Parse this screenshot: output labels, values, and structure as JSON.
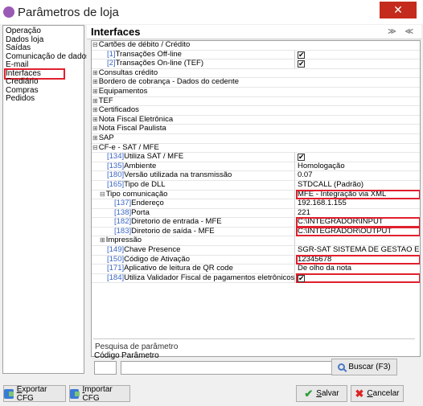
{
  "window": {
    "title": "Parâmetros de loja",
    "close": "✕"
  },
  "sidebar": {
    "items": [
      {
        "label": "Operação",
        "active": false
      },
      {
        "label": "Dados loja",
        "active": false
      },
      {
        "label": "Saídas",
        "active": false
      },
      {
        "label": "Comunicação de dados",
        "active": false
      },
      {
        "label": "E-mail",
        "active": false
      },
      {
        "label": "Interfaces",
        "active": true
      },
      {
        "label": "Crediário",
        "active": false
      },
      {
        "label": "Compras",
        "active": false
      },
      {
        "label": "Pedidos",
        "active": false
      }
    ]
  },
  "panel": {
    "title": "Interfaces",
    "icons": "≫ ≪"
  },
  "grid": {
    "rows": [
      {
        "indent": 0,
        "exp": "⊟",
        "code": "",
        "label": "Cartões de débito / Crédito",
        "value": "",
        "checkbox": false,
        "group": true,
        "highlight": false
      },
      {
        "indent": 2,
        "exp": "",
        "code": "[1]",
        "label": "Transações Off-line",
        "value": "",
        "checkbox": true,
        "group": false,
        "highlight": false
      },
      {
        "indent": 2,
        "exp": "",
        "code": "[2]",
        "label": "Transações On-line (TEF)",
        "value": "",
        "checkbox": true,
        "group": false,
        "highlight": false
      },
      {
        "indent": 0,
        "exp": "⊞",
        "code": "",
        "label": "Consultas crédito",
        "value": "",
        "checkbox": false,
        "group": true,
        "highlight": false
      },
      {
        "indent": 0,
        "exp": "⊞",
        "code": "",
        "label": "Bordero de cobrança - Dados do cedente",
        "value": "",
        "checkbox": false,
        "group": true,
        "highlight": false
      },
      {
        "indent": 0,
        "exp": "⊞",
        "code": "",
        "label": "Equipamentos",
        "value": "",
        "checkbox": false,
        "group": true,
        "highlight": false
      },
      {
        "indent": 0,
        "exp": "⊞",
        "code": "",
        "label": "TEF",
        "value": "",
        "checkbox": false,
        "group": true,
        "highlight": false
      },
      {
        "indent": 0,
        "exp": "⊞",
        "code": "",
        "label": "Certificados",
        "value": "",
        "checkbox": false,
        "group": true,
        "highlight": false
      },
      {
        "indent": 0,
        "exp": "⊞",
        "code": "",
        "label": "Nota Fiscal Eletrônica",
        "value": "",
        "checkbox": false,
        "group": true,
        "highlight": false
      },
      {
        "indent": 0,
        "exp": "⊞",
        "code": "",
        "label": "Nota Fiscal Paulista",
        "value": "",
        "checkbox": false,
        "group": true,
        "highlight": false
      },
      {
        "indent": 0,
        "exp": "⊞",
        "code": "",
        "label": "SAP",
        "value": "",
        "checkbox": false,
        "group": true,
        "highlight": false
      },
      {
        "indent": 0,
        "exp": "⊟",
        "code": "",
        "label": "CF-e - SAT / MFE",
        "value": "",
        "checkbox": false,
        "group": true,
        "highlight": false
      },
      {
        "indent": 2,
        "exp": "",
        "code": "[134]",
        "label": "Utiliza SAT / MFE",
        "value": "",
        "checkbox": true,
        "group": false,
        "highlight": false
      },
      {
        "indent": 2,
        "exp": "",
        "code": "[135]",
        "label": "Ambiente",
        "value": "Homologação",
        "checkbox": false,
        "group": false,
        "highlight": false
      },
      {
        "indent": 2,
        "exp": "",
        "code": "[180]",
        "label": "Versão utilizada na transmissão",
        "value": "0.07",
        "checkbox": false,
        "group": false,
        "highlight": false
      },
      {
        "indent": 2,
        "exp": "",
        "code": "[165]",
        "label": "Tipo de DLL",
        "value": "STDCALL (Padrão)",
        "checkbox": false,
        "group": false,
        "highlight": false
      },
      {
        "indent": 1,
        "exp": "⊟",
        "code": "",
        "label": "Tipo comunicação",
        "value": "MFE - Integração via XML",
        "checkbox": false,
        "group": false,
        "highlight": true
      },
      {
        "indent": 3,
        "exp": "",
        "code": "[137]",
        "label": "Endereço",
        "value": "192.168.1.155",
        "checkbox": false,
        "group": false,
        "highlight": false
      },
      {
        "indent": 3,
        "exp": "",
        "code": "[138]",
        "label": "Porta",
        "value": "221",
        "checkbox": false,
        "group": false,
        "highlight": false
      },
      {
        "indent": 3,
        "exp": "",
        "code": "[182]",
        "label": "Diretorio de entrada - MFE",
        "value": "C:\\INTEGRADOR\\INPUT",
        "checkbox": false,
        "group": false,
        "highlight": true
      },
      {
        "indent": 3,
        "exp": "",
        "code": "[183]",
        "label": "Diretorio de saída - MFE",
        "value": "C:\\INTEGRADOR\\OUTPUT",
        "checkbox": false,
        "group": false,
        "highlight": true
      },
      {
        "indent": 1,
        "exp": "⊞",
        "code": "",
        "label": "Impressão",
        "value": "",
        "checkbox": false,
        "group": false,
        "highlight": false
      },
      {
        "indent": 2,
        "exp": "",
        "code": "[149]",
        "label": "Chave Presence",
        "value": "SGR-SAT SISTEMA DE GESTAO E R",
        "checkbox": false,
        "group": false,
        "highlight": false
      },
      {
        "indent": 2,
        "exp": "",
        "code": "[150]",
        "label": "Código de Ativação",
        "value": "12345678",
        "checkbox": false,
        "group": false,
        "highlight": true
      },
      {
        "indent": 2,
        "exp": "",
        "code": "[171]",
        "label": "Aplicativo de leitura de QR code",
        "value": "De olho da nota",
        "checkbox": false,
        "group": false,
        "highlight": false
      },
      {
        "indent": 2,
        "exp": "",
        "code": "[184]",
        "label": "Utiliza Validador Fiscal de pagamentos eletrônicos - VFPe",
        "value": "",
        "checkbox": true,
        "group": false,
        "highlight": true
      }
    ]
  },
  "search": {
    "title": "Pesquisa de parâmetro",
    "code_label": "Código",
    "param_label": "Parâmetro",
    "code_value": "",
    "param_value": "",
    "button": "Buscar (F3)"
  },
  "footer": {
    "export_pre": "E",
    "export_rest": "xportar CFG",
    "import_pre": "I",
    "import_rest": "mportar CFG",
    "save_pre": "S",
    "save_rest": "alvar",
    "cancel_pre": "C",
    "cancel_rest": "ancelar"
  }
}
